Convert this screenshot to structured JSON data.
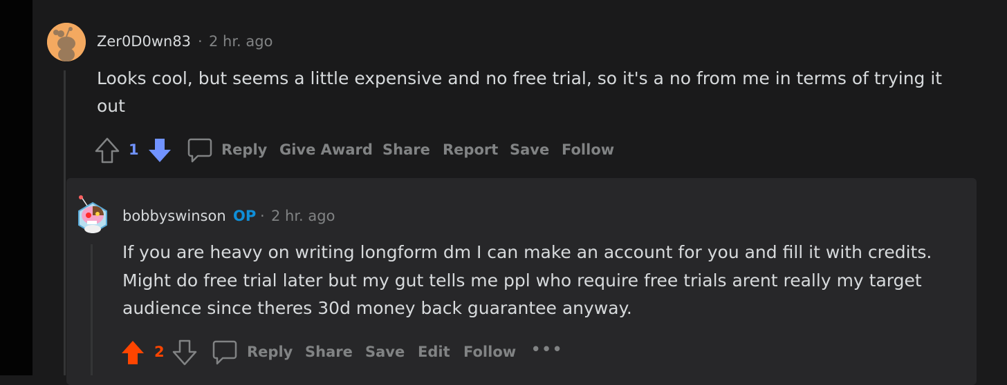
{
  "comment1": {
    "author": "Zer0D0wn83",
    "separator": "·",
    "timestamp": "2 hr. ago",
    "body_line1": "Looks cool, but seems a little expensive and no free trial, so it's a no from me in terms of trying it",
    "body_line2": "out",
    "vote_count": "1",
    "actions": [
      "Reply",
      "Give Award",
      "Share",
      "Report",
      "Save",
      "Follow"
    ]
  },
  "comment2": {
    "author": "bobbyswinson",
    "op_badge": "OP",
    "separator": "·",
    "timestamp": "2 hr. ago",
    "body_line1": "If you are heavy on writing longform dm I can make an account for you and fill it with credits.",
    "body_line2": "Might do free trial later but my gut tells me ppl who require free trials arent really my target",
    "body_line3": "audience since theres 30d money back guarantee anyway.",
    "vote_count": "2",
    "actions": [
      "Reply",
      "Share",
      "Save",
      "Edit",
      "Follow"
    ],
    "more_label": "•••"
  },
  "colors": {
    "background": "#1a1a1b",
    "card": "#272729",
    "upvote": "#ff4500",
    "downvote": "#7193ff",
    "op": "#0f8fd8",
    "muted": "#818384"
  }
}
